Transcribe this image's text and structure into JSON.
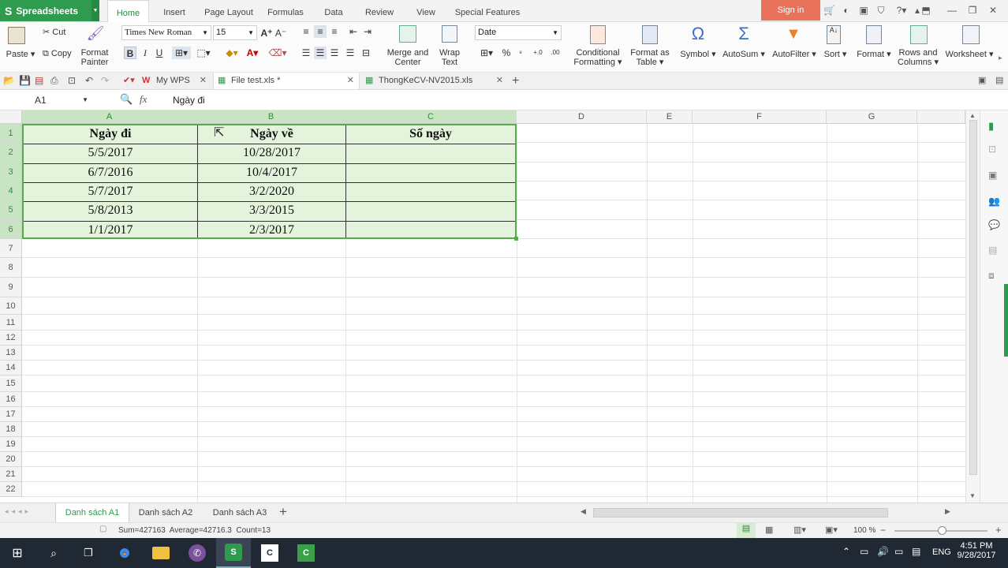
{
  "app": {
    "name": "Spreadsheets",
    "accent": "#2f9b4e"
  },
  "menu_tabs": [
    "Home",
    "Insert",
    "Page Layout",
    "Formulas",
    "Data",
    "Review",
    "View",
    "Special Features"
  ],
  "signin_label": "Sign in",
  "ribbon": {
    "paste": "Paste",
    "cut": "Cut",
    "copy": "Copy",
    "format_painter_1": "Format",
    "format_painter_2": "Painter",
    "font_name": "Times New Roman",
    "font_size": "15",
    "merge_1": "Merge and",
    "merge_2": "Center",
    "wrap_1": "Wrap",
    "wrap_2": "Text",
    "number_format": "Date",
    "conditional_1": "Conditional",
    "conditional_2": "Formatting",
    "format_table_1": "Format as",
    "format_table_2": "Table",
    "symbol": "Symbol",
    "autosum": "AutoSum",
    "autofilter": "AutoFilter",
    "sort": "Sort",
    "format": "Format",
    "rows_cols_1": "Rows and",
    "rows_cols_2": "Columns",
    "worksheet": "Worksheet"
  },
  "doc_tabs": [
    {
      "label": "My WPS"
    },
    {
      "label": "File test.xls *"
    },
    {
      "label": "ThongKeCV-NV2015.xls"
    }
  ],
  "formula_bar": {
    "cell_ref": "A1",
    "fx": "fx",
    "content": "Ngày đi"
  },
  "columns": [
    "A",
    "B",
    "C",
    "D",
    "E",
    "F",
    "G"
  ],
  "rows": [
    "1",
    "2",
    "3",
    "4",
    "5",
    "6",
    "7",
    "8",
    "9",
    "10",
    "11",
    "12",
    "13",
    "14",
    "15",
    "16",
    "17",
    "18",
    "19",
    "20",
    "21",
    "22"
  ],
  "table": {
    "headers": [
      "Ngày đi",
      "Ngày về",
      "Số ngày"
    ],
    "data": [
      [
        "5/5/2017",
        "10/28/2017",
        ""
      ],
      [
        "6/7/2016",
        "10/4/2017",
        ""
      ],
      [
        "5/7/2017",
        "3/2/2020",
        ""
      ],
      [
        "5/8/2013",
        "3/3/2015",
        ""
      ],
      [
        "1/1/2017",
        "2/3/2017",
        ""
      ]
    ]
  },
  "sheet_tabs": [
    "Danh sách A1",
    "Danh sách A2",
    "Danh sách A3"
  ],
  "status": {
    "summary": "Sum=427163  Average=42716.3  Count=13",
    "zoom": "100 %"
  },
  "taskbar": {
    "lang": "ENG",
    "time": "4:51 PM",
    "date": "9/28/2017"
  }
}
